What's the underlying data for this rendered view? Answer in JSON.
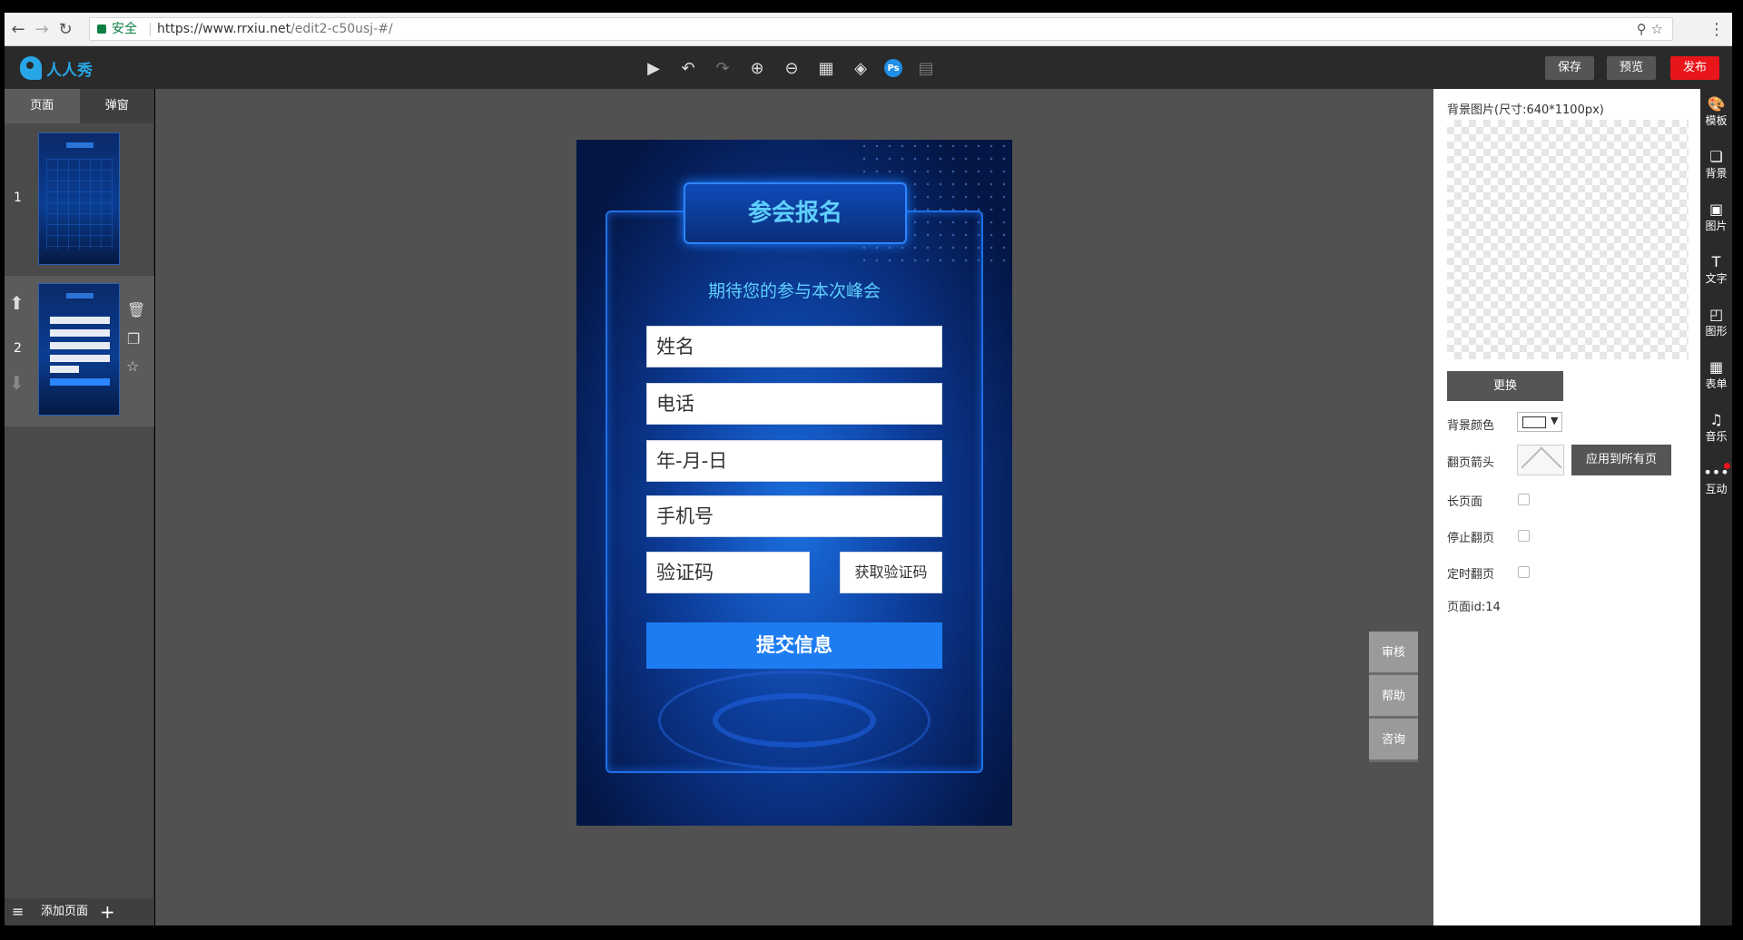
{
  "browser": {
    "secure_label": "安全",
    "url_domain": "https://www.rrxiu.net",
    "url_path": "/edit2-c50usj-#/"
  },
  "app": {
    "logo_text": "人人秀",
    "buttons": {
      "save": "保存",
      "preview": "预览",
      "publish": "发布"
    },
    "toolbar_icons": [
      "play-icon",
      "undo-icon",
      "redo-icon",
      "zoom-in-icon",
      "zoom-out-icon",
      "grid-icon",
      "layers-icon",
      "ps-icon",
      "align-icon"
    ]
  },
  "left_panel": {
    "tabs": [
      "页面",
      "弹窗"
    ],
    "pages": [
      {
        "number": "1"
      },
      {
        "number": "2"
      }
    ],
    "footer_add": "添加页面"
  },
  "canvas": {
    "title": "参会报名",
    "subtitle": "期待您的参与本次峰会",
    "fields": [
      "姓名",
      "电话",
      "年-月-日",
      "手机号",
      "验证码"
    ],
    "get_code": "获取验证码",
    "submit": "提交信息"
  },
  "side_tools": [
    "审核",
    "帮助",
    "咨询"
  ],
  "settings": {
    "bg_image_label": "背景图片(尺寸:640*1100px)",
    "replace": "更换",
    "bg_color_label": "背景颜色",
    "page_arrow_label": "翻页箭头",
    "apply_all": "应用到所有页",
    "long_page": "长页面",
    "stop_flip": "停止翻页",
    "timed_flip": "定时翻页",
    "page_id": "页面id:14"
  },
  "right_strip": [
    "模板",
    "背景",
    "图片",
    "文字",
    "图形",
    "表单",
    "音乐",
    "互动"
  ],
  "colors": {
    "accent": "#28a7e8",
    "publish": "#e8151b",
    "submit": "#1d7cf2"
  }
}
